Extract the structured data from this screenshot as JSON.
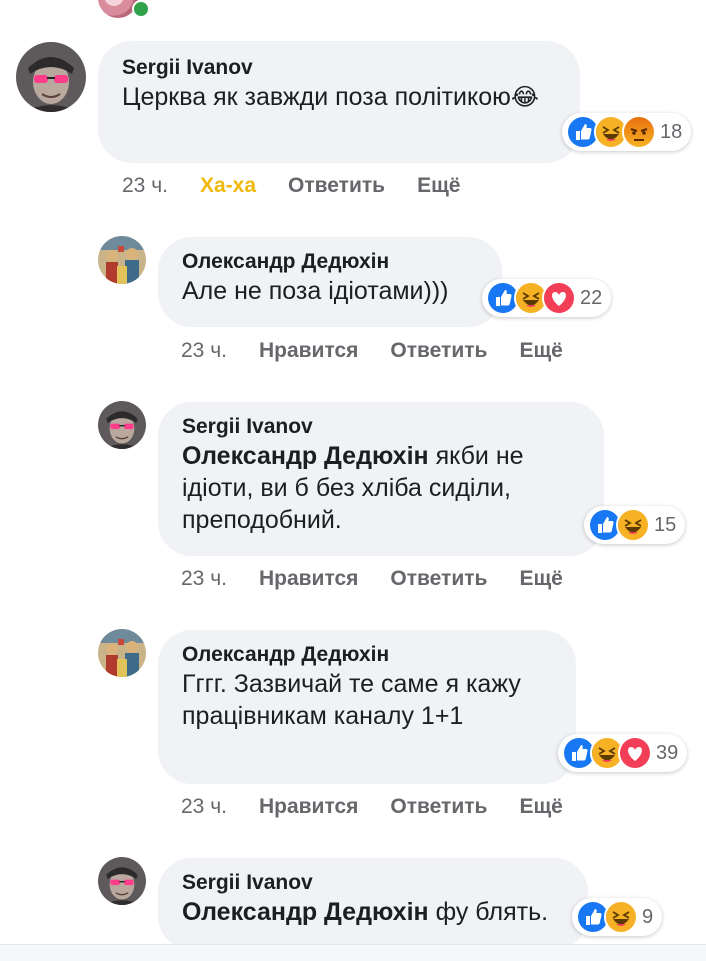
{
  "comments": [
    {
      "author": "Sergii Ivanov",
      "text": "Церква як завжди поза політикою",
      "mention": "",
      "emoji": "😂",
      "reaction_count": "18",
      "reactions": [
        "like-icon",
        "haha-icon",
        "angry-icon"
      ],
      "time": "23 ч.",
      "like_label": "Ха-ха",
      "reply_label": "Ответить",
      "more_label": "Ещё"
    },
    {
      "author": "Олександр Дедюхін",
      "text": "Але не поза ідіотами)))",
      "mention": "",
      "reaction_count": "22",
      "reactions": [
        "like-icon",
        "haha-icon",
        "love-icon"
      ],
      "time": "23 ч.",
      "like_label": "Нравится",
      "reply_label": "Ответить",
      "more_label": "Ещё"
    },
    {
      "author": "Sergii Ivanov",
      "mention": "Олександр Дедюхін",
      "text": "якби не ідіоти, ви б без хліба сиділи, преподобний.",
      "reaction_count": "15",
      "reactions": [
        "like-icon",
        "haha-icon"
      ],
      "time": "23 ч.",
      "like_label": "Нравится",
      "reply_label": "Ответить",
      "more_label": "Ещё"
    },
    {
      "author": "Олександр Дедюхін",
      "text": "Гггг. Зазвичай те саме я кажу працівникам каналу 1+1",
      "mention": "",
      "reaction_count": "39",
      "reactions": [
        "like-icon",
        "haha-icon",
        "love-icon"
      ],
      "time": "23 ч.",
      "like_label": "Нравится",
      "reply_label": "Ответить",
      "more_label": "Ещё"
    },
    {
      "author": "Sergii Ivanov",
      "mention": "Олександр Дедюхін",
      "text": "фу блять.",
      "reaction_count": "9",
      "reactions": [
        "like-icon",
        "haha-icon"
      ]
    }
  ],
  "colors": {
    "bubble": "#f0f2f5",
    "meta": "#65676b",
    "haha_active": "#f0b90b",
    "like": "#1877f2",
    "love": "#f33e58",
    "haha": "#f7b125",
    "online": "#31a24c"
  }
}
